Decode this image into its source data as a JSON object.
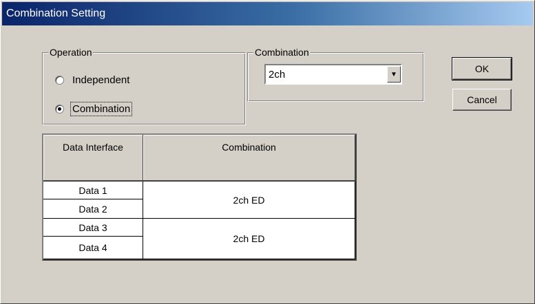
{
  "window": {
    "title": "Combination Setting"
  },
  "operation": {
    "legend": "Operation",
    "options": [
      {
        "label": "Independent",
        "checked": false
      },
      {
        "label": "Combination",
        "checked": true
      }
    ]
  },
  "combination": {
    "legend": "Combination",
    "selected": "2ch"
  },
  "buttons": {
    "ok": "OK",
    "cancel": "Cancel"
  },
  "table": {
    "headers": [
      "Data Interface",
      "Combination"
    ],
    "rows": [
      {
        "interfaces": [
          "Data 1",
          "Data 2"
        ],
        "combination": "2ch ED"
      },
      {
        "interfaces": [
          "Data 3",
          "Data 4"
        ],
        "combination": "2ch ED"
      }
    ]
  }
}
